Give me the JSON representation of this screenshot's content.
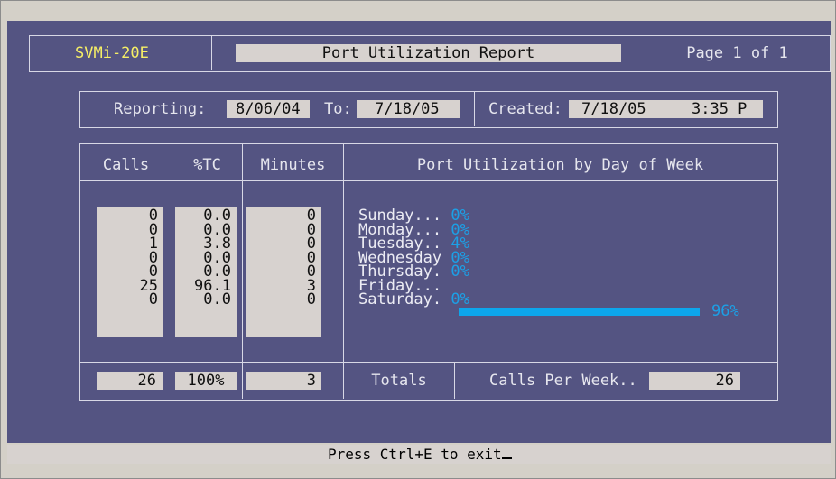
{
  "header": {
    "model": "SVMi-20E",
    "title": "Port Utilization Report",
    "page": "Page 1 of 1"
  },
  "dates": {
    "reporting_label": "Reporting:",
    "reporting_from": "8/06/04",
    "to_label": "To:",
    "reporting_to": "7/18/05",
    "created_label": "Created:",
    "created_date": "7/18/05",
    "created_time": "3:35 P"
  },
  "table": {
    "col_calls": "Calls",
    "col_tc": "%TC",
    "col_minutes": "Minutes",
    "chart_title": "Port Utilization by Day of Week",
    "rows": [
      {
        "day": "Sunday...",
        "calls": "0",
        "tc": "0.0",
        "minutes": "0",
        "pct": "0%"
      },
      {
        "day": "Monday...",
        "calls": "0",
        "tc": "0.0",
        "minutes": "0",
        "pct": "0%"
      },
      {
        "day": "Tuesday..",
        "calls": "1",
        "tc": "3.8",
        "minutes": "0",
        "pct": "4%"
      },
      {
        "day": "Wednesday",
        "calls": "0",
        "tc": "0.0",
        "minutes": "0",
        "pct": "0%"
      },
      {
        "day": "Thursday.",
        "calls": "0",
        "tc": "0.0",
        "minutes": "0",
        "pct": "0%"
      },
      {
        "day": "Friday...",
        "calls": "25",
        "tc": "96.1",
        "minutes": "3",
        "pct": "96%"
      },
      {
        "day": "Saturday.",
        "calls": "0",
        "tc": "0.0",
        "minutes": "0",
        "pct": "0%"
      }
    ],
    "utilization_fraction": [
      0,
      0,
      0.04,
      0,
      0,
      0.96,
      0
    ]
  },
  "totals": {
    "calls": "26",
    "tc": "100%",
    "minutes": "3",
    "label": "Totals",
    "calls_per_week_label": "Calls Per Week..",
    "calls_per_week": "26"
  },
  "status": {
    "text": "Press Ctrl+E to exit"
  },
  "colors": {
    "background": "#545482",
    "field": "#d7d2cf",
    "accent": "#0da6ec",
    "highlight": "#f6ef66"
  }
}
